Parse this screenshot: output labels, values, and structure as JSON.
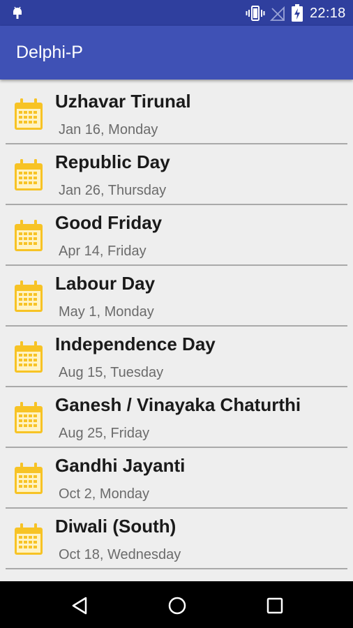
{
  "status_bar": {
    "time": "22:18",
    "icons": [
      "android-debug-icon",
      "vibrate-icon",
      "no-signal-icon",
      "battery-charging-icon"
    ]
  },
  "app_bar": {
    "title": "Delphi-P"
  },
  "holidays": [
    {
      "name": "Uzhavar Tirunal",
      "date": "Jan 16, Monday"
    },
    {
      "name": "Republic Day",
      "date": "Jan 26, Thursday"
    },
    {
      "name": "Good Friday",
      "date": "Apr 14, Friday"
    },
    {
      "name": "Labour Day",
      "date": "May 1, Monday"
    },
    {
      "name": "Independence Day",
      "date": "Aug 15, Tuesday"
    },
    {
      "name": "Ganesh / Vinayaka Chaturthi",
      "date": "Aug 25, Friday"
    },
    {
      "name": "Gandhi Jayanti",
      "date": "Oct 2, Monday"
    },
    {
      "name": "Diwali (South)",
      "date": "Oct 18, Wednesday"
    }
  ],
  "nav_bar": {
    "buttons": [
      "back-icon",
      "home-icon",
      "recents-icon"
    ]
  },
  "colors": {
    "status_bar": "#2f3f9e",
    "app_bar": "#3f51b5",
    "background": "#eeeeee",
    "calendar_icon": "#f7c325"
  }
}
